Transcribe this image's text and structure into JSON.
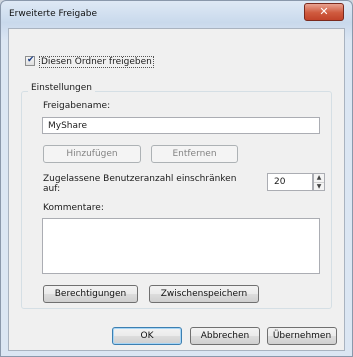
{
  "window": {
    "title": "Erweiterte Freigabe",
    "close_glyph": "✕"
  },
  "share_checkbox": {
    "label": "Diesen Ordner freigeben",
    "checked": true,
    "mark": "✔"
  },
  "settings": {
    "group_label": "Einstellungen",
    "share_name_label": "Freigabename:",
    "share_name_value": "MyShare",
    "add_button": "Hinzufügen",
    "remove_button": "Entfernen",
    "user_limit_label_line1": "Zugelassene Benutzeranzahl einschränken",
    "user_limit_label_line2": "auf:",
    "user_limit_value": "20",
    "comments_label": "Kommentare:",
    "comments_value": "",
    "permissions_button": "Berechtigungen",
    "caching_button": "Zwischenspeichern"
  },
  "footer": {
    "ok": "OK",
    "cancel": "Abbrechen",
    "apply": "Übernehmen"
  },
  "icons": {
    "spin_up": "▲",
    "spin_down": "▼"
  }
}
